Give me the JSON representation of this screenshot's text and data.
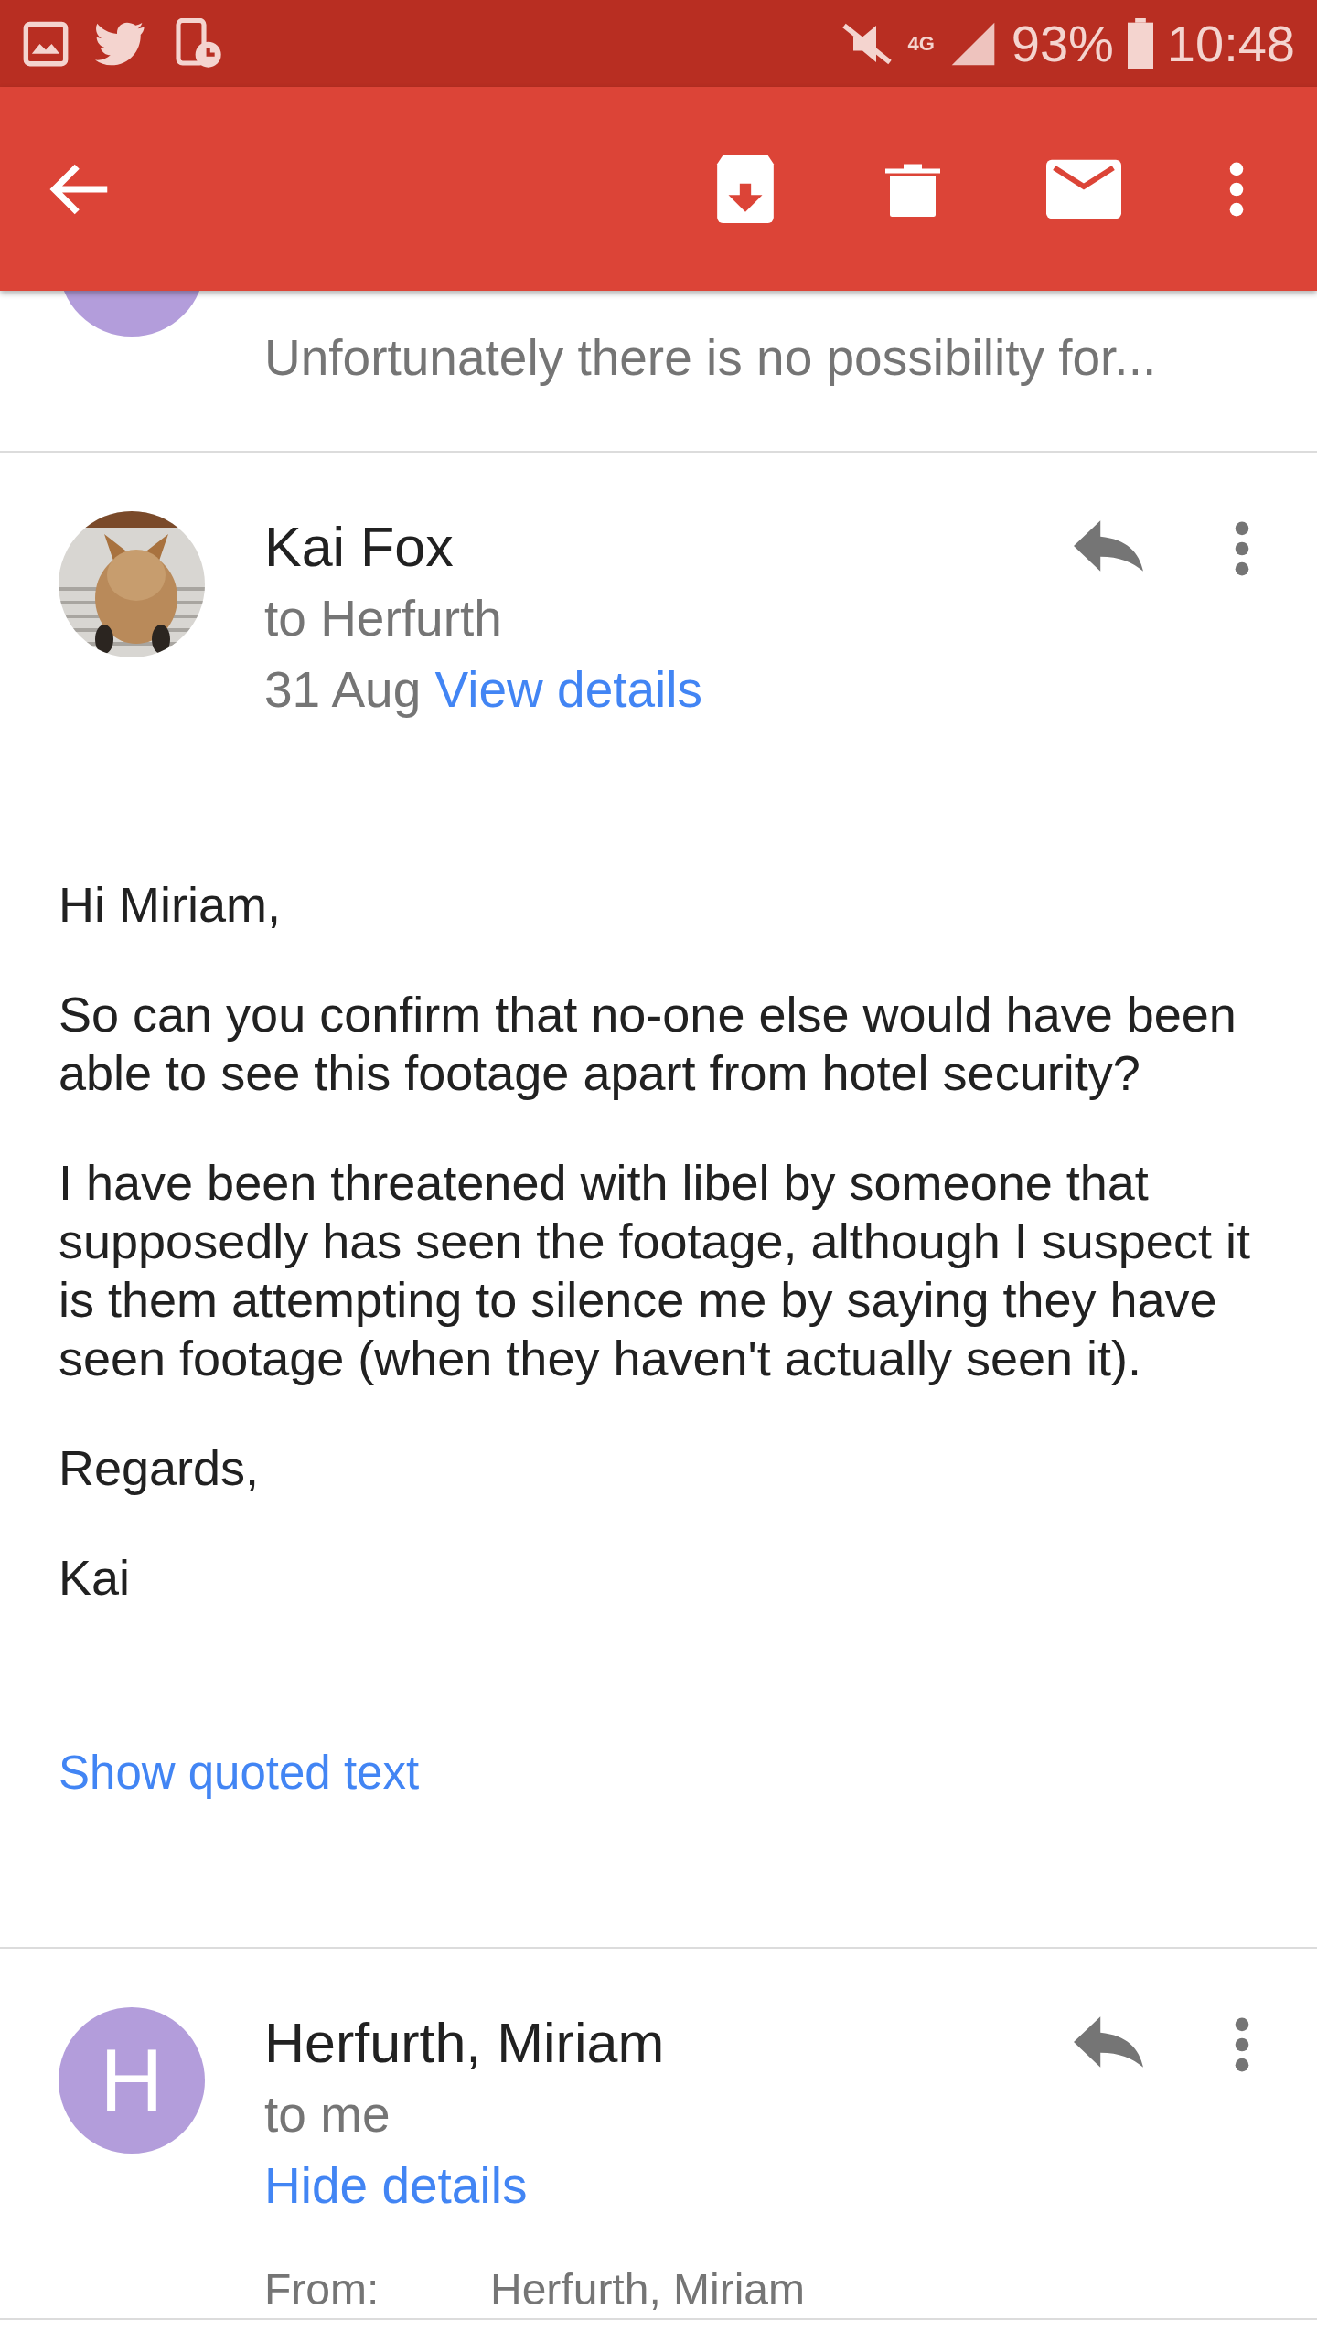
{
  "status_bar": {
    "network": "4G",
    "battery": "93%",
    "time": "10:48"
  },
  "messages": [
    {
      "kind": "snippet",
      "snippet": "Unfortunately there is no possibility for..."
    },
    {
      "kind": "expanded",
      "sender": "Kai Fox",
      "recipient": "to Herfurth",
      "date": "31 Aug",
      "details_link": "View details",
      "body": [
        "Hi Miriam,",
        "So can you confirm that no-one else would have been able to see this footage apart from hotel security?",
        "I have been threatened with libel by someone that supposedly has seen the footage, although I suspect it is them attempting to silence me by saying they have seen footage (when they haven't actually seen it).",
        "Regards,",
        "Kai"
      ],
      "quoted_link": "Show quoted text"
    },
    {
      "kind": "expanded",
      "avatar": {
        "kind": "letter",
        "letter": "H"
      },
      "sender": "Herfurth, Miriam",
      "recipient": "to me",
      "details_link": "Hide details",
      "details": [
        {
          "label": "From:",
          "name": "Herfurth, Miriam"
        }
      ]
    }
  ]
}
